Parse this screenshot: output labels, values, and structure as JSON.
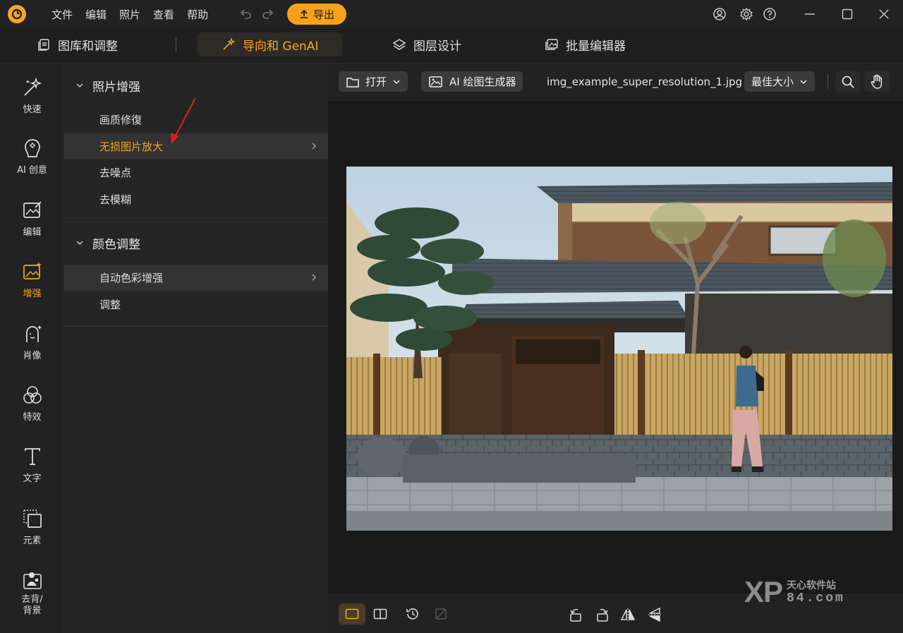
{
  "titlebar": {
    "menus": [
      "文件",
      "编辑",
      "照片",
      "查看",
      "帮助"
    ],
    "export_label": "导出",
    "icons": [
      "account-icon",
      "settings-icon",
      "help-icon",
      "minimize-icon",
      "maximize-icon",
      "close-icon"
    ]
  },
  "tabs": [
    "图库和调整",
    "导向和 GenAI",
    "图层设计",
    "批量编辑器"
  ],
  "active_tab": "导向和 GenAI",
  "rail": [
    "快速",
    "AI 创意",
    "编辑",
    "增强",
    "肖像",
    "特效",
    "文字",
    "元素",
    "去背/\n背景"
  ],
  "active_rail": "增强",
  "panel": {
    "sections": [
      {
        "title": "照片增强",
        "items": [
          "画质修復",
          "无损图片放大",
          "去噪点",
          "去模糊"
        ]
      },
      {
        "title": "颜色调整",
        "items": [
          "自动色彩增强",
          "调整"
        ]
      }
    ],
    "selected_item": "无损图片放大"
  },
  "canvas": {
    "open_label": "打开",
    "ai_label": "AI 绘图生成器",
    "filename": "img_example_super_resolution_1.jpg",
    "zoom_label": "最佳大小"
  },
  "watermark": {
    "xp": "XP",
    "cn": "天心软件站",
    "num": "84.com"
  },
  "colors": {
    "accent": "#f5a623",
    "bg": "#1e1e1e",
    "panel": "#252525"
  }
}
